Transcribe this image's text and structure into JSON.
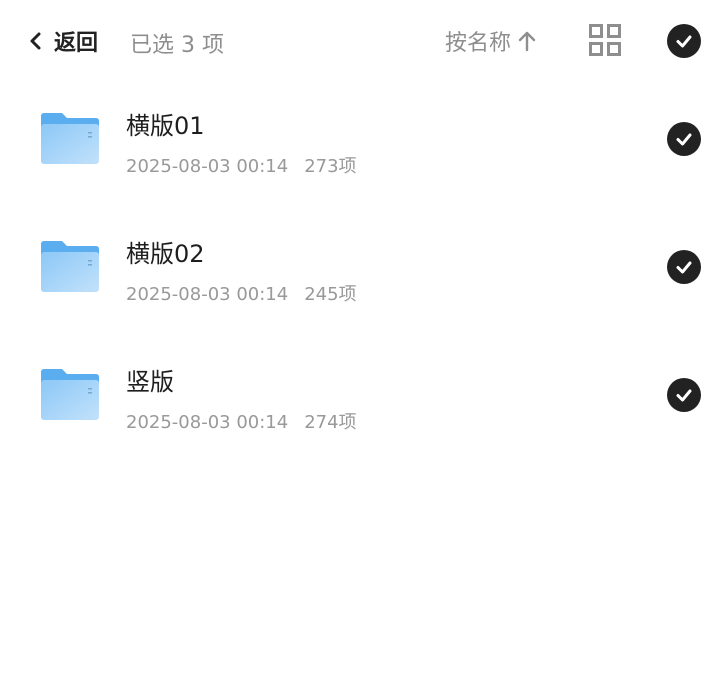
{
  "header": {
    "back_label": "返回",
    "selection_text": "已选 3 项",
    "sort_label": "按名称"
  },
  "icons": {
    "back": "chevron-left-icon",
    "sort": "arrow-up-icon",
    "view": "grid-view-icon",
    "select": "check-circle-icon",
    "folder": "folder-icon"
  },
  "colors": {
    "text_primary": "#222222",
    "text_secondary": "#8e8e8e",
    "check_fill": "#222222",
    "folder_blue": "#5aaef0"
  },
  "folders": [
    {
      "name": "横版01",
      "date": "2025-08-03 00:14",
      "count": "273项",
      "selected": true
    },
    {
      "name": "横版02",
      "date": "2025-08-03 00:14",
      "count": "245项",
      "selected": true
    },
    {
      "name": "竖版",
      "date": "2025-08-03 00:14",
      "count": "274项",
      "selected": true
    }
  ]
}
